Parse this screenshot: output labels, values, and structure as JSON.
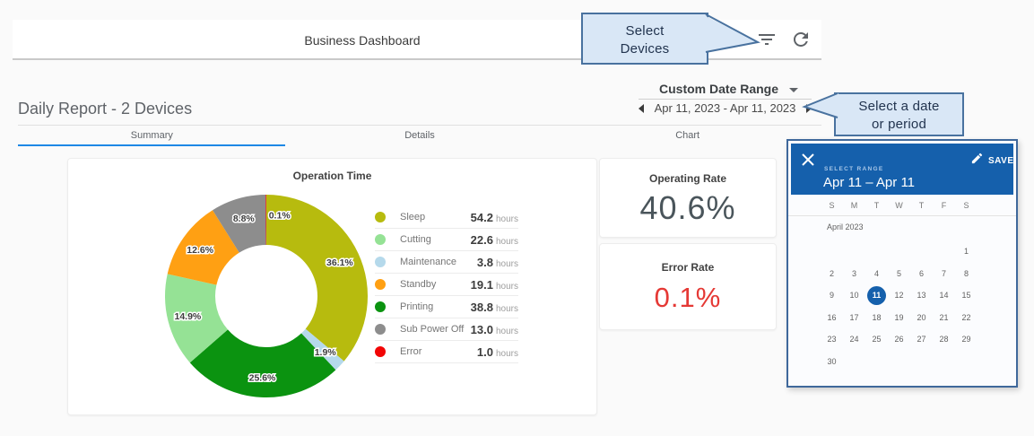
{
  "header": {
    "title": "Business Dashboard"
  },
  "toolbar": {
    "filter_icon": "filter-list",
    "refresh_icon": "refresh"
  },
  "callouts": {
    "devices": {
      "lines": [
        "Select",
        "Devices"
      ]
    },
    "date": {
      "lines": [
        "Select a date",
        "or period"
      ]
    }
  },
  "date_range": {
    "label": "Custom Date Range",
    "value": "Apr 11, 2023 - Apr 11, 2023"
  },
  "report": {
    "title": "Daily Report - 2 Devices"
  },
  "tabs": [
    {
      "label": "Summary",
      "active": true
    },
    {
      "label": "Details",
      "active": false
    },
    {
      "label": "Chart",
      "active": false
    }
  ],
  "chart_data": {
    "type": "pie",
    "donut": true,
    "title": "Operation Time",
    "unit": "hours",
    "legend_position": "right",
    "series": [
      {
        "name": "Sleep",
        "hours": 54.2,
        "percent": 36.1,
        "color": "#b7bb0e"
      },
      {
        "name": "Cutting",
        "hours": 22.6,
        "percent": 14.9,
        "color": "#95e295"
      },
      {
        "name": "Maintenance",
        "hours": 3.8,
        "percent": 1.9,
        "color": "#b5d9eb"
      },
      {
        "name": "Standby",
        "hours": 19.1,
        "percent": 12.6,
        "color": "#ffa013"
      },
      {
        "name": "Printing",
        "hours": 38.8,
        "percent": 25.6,
        "color": "#0b9310"
      },
      {
        "name": "Sub Power Off",
        "hours": 13.0,
        "percent": 8.8,
        "color": "#8d8d8d"
      },
      {
        "name": "Error",
        "hours": 1.0,
        "percent": 0.1,
        "color": "#f20505"
      }
    ],
    "slice_order": [
      "Sleep",
      "Maintenance",
      "Printing",
      "Cutting",
      "Standby",
      "Sub Power Off",
      "Error"
    ]
  },
  "metrics": [
    {
      "label": "Operating Rate",
      "value": "40.6%",
      "color": "#4a555b"
    },
    {
      "label": "Error Rate",
      "value": "0.1%",
      "color": "#e53935"
    }
  ],
  "calendar": {
    "close_icon": "close",
    "edit_icon": "pencil",
    "save_label": "SAVE",
    "select_range_label": "SELECT RANGE",
    "range_text": "Apr 11 – Apr 11",
    "weekdays": [
      "S",
      "M",
      "T",
      "W",
      "T",
      "F",
      "S"
    ],
    "month_label": "April 2023",
    "weeks": [
      [
        "",
        "",
        "",
        "",
        "",
        "",
        "1"
      ],
      [
        "2",
        "3",
        "4",
        "5",
        "6",
        "7",
        "8"
      ],
      [
        "9",
        "10",
        "11",
        "12",
        "13",
        "14",
        "15"
      ],
      [
        "16",
        "17",
        "18",
        "19",
        "20",
        "21",
        "22"
      ],
      [
        "23",
        "24",
        "25",
        "26",
        "27",
        "28",
        "29"
      ],
      [
        "30",
        "",
        "",
        "",
        "",
        "",
        ""
      ]
    ],
    "selected_day": "11",
    "header_color": "#1560ac"
  }
}
